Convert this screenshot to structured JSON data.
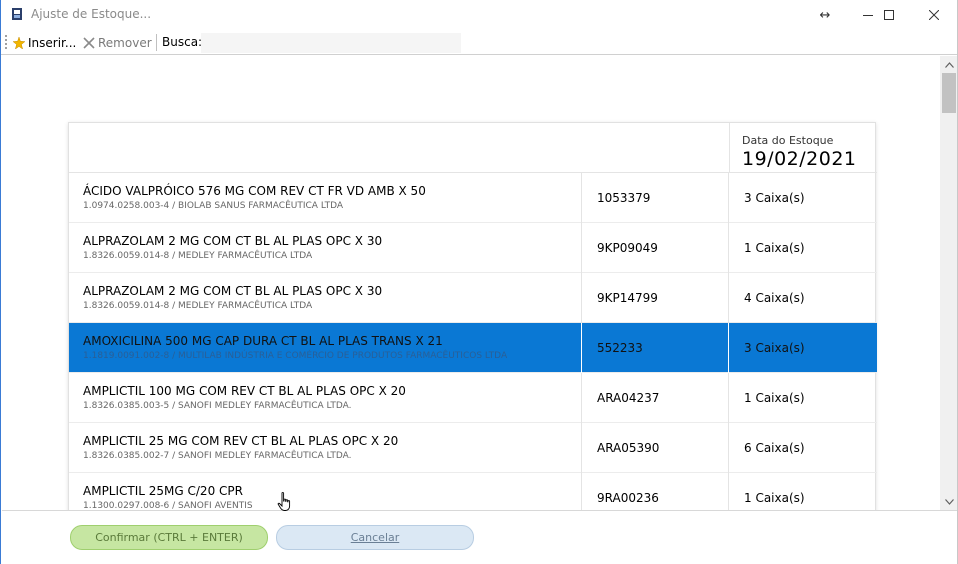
{
  "window": {
    "title": "Ajuste de Estoque...",
    "controls": {
      "resize_glyph": "↔",
      "minimize_glyph": "—",
      "maximize_glyph": "☐",
      "close_glyph": "✕"
    }
  },
  "toolbar": {
    "insert_label": "Inserir...",
    "remove_label": "Remover",
    "search_label": "Busca:",
    "search_value": ""
  },
  "header": {
    "date_label": "Data do Estoque",
    "date_value": "19/02/2021"
  },
  "rows": [
    {
      "name": "ÁCIDO VALPRÓICO 576 MG COM REV CT FR VD AMB X 50",
      "sub": "1.0974.0258.003-4 / BIOLAB SANUS FARMACÊUTICA LTDA",
      "lot": "1053379",
      "qty": "3 Caixa(s)"
    },
    {
      "name": "ALPRAZOLAM 2 MG COM CT BL AL PLAS OPC X 30",
      "sub": "1.8326.0059.014-8 / MEDLEY FARMACÊUTICA LTDA",
      "lot": "9KP09049",
      "qty": "1 Caixa(s)"
    },
    {
      "name": "ALPRAZOLAM 2 MG COM CT BL AL PLAS OPC X 30",
      "sub": "1.8326.0059.014-8 / MEDLEY FARMACÊUTICA LTDA",
      "lot": "9KP14799",
      "qty": "4 Caixa(s)"
    },
    {
      "name": "AMOXICILINA 500 MG CAP DURA CT BL AL PLAS TRANS X 21",
      "sub": "1.1819.0091.002-8 / MULTILAB INDÚSTRIA E COMÉRCIO DE PRODUTOS FARMACÊUTICOS LTDA",
      "lot": "552233",
      "qty": "3 Caixa(s)"
    },
    {
      "name": "AMPLICTIL 100 MG COM REV CT BL AL PLAS OPC X 20",
      "sub": "1.8326.0385.003-5 / SANOFI MEDLEY FARMACÊUTICA LTDA.",
      "lot": "ARA04237",
      "qty": "1 Caixa(s)"
    },
    {
      "name": "AMPLICTIL 25 MG COM REV CT BL AL PLAS OPC X 20",
      "sub": "1.8326.0385.002-7 / SANOFI MEDLEY FARMACÊUTICA LTDA.",
      "lot": "ARA05390",
      "qty": "6 Caixa(s)"
    },
    {
      "name": "AMPLICTIL 25MG C/20 CPR",
      "sub": "1.1300.0297.008-6 / SANOFI AVENTIS",
      "lot": "9RA00236",
      "qty": "1 Caixa(s)"
    }
  ],
  "selected_row": 3,
  "footer": {
    "confirm_label": "Confirmar (CTRL + ENTER)",
    "cancel_label": "Cancelar"
  },
  "colors": {
    "selection": "#0a78d4",
    "confirm_bg": "#c6e6a2",
    "cancel_bg": "#dbe8f4"
  },
  "icons": {
    "app": "app-window-icon",
    "insert": "star-icon",
    "remove": "close-x-icon",
    "cursor": "hand-pointer-icon"
  }
}
